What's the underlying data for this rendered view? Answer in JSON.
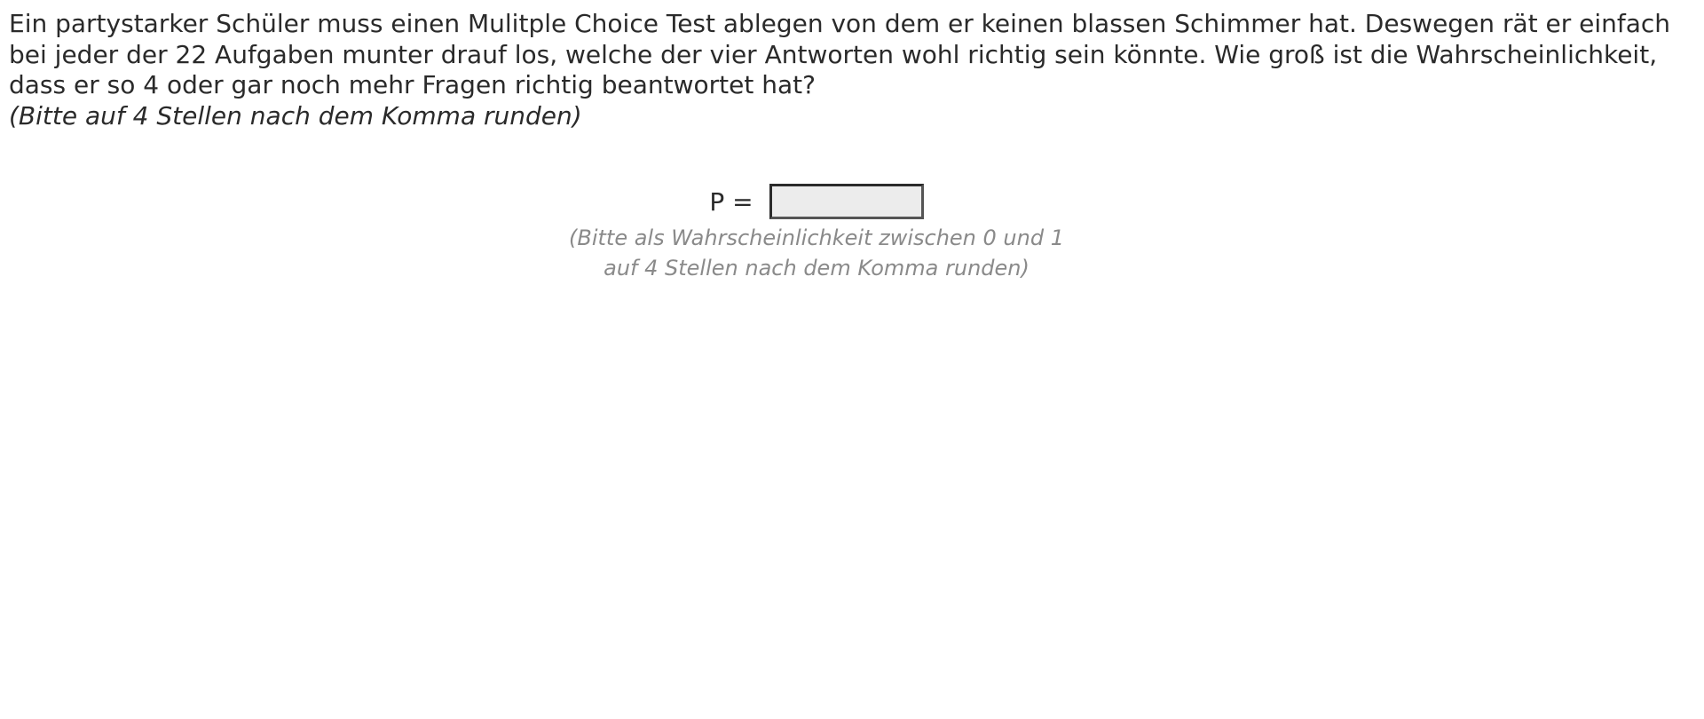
{
  "question": {
    "text": "Ein partystarker Schüler muss einen Mulitple Choice Test ablegen von dem er keinen blassen Schimmer hat. Deswegen rät er einfach bei jeder der 22 Aufgaben munter drauf los, welche der vier Antworten wohl richtig sein könnte. Wie groß ist die Wahrscheinlichkeit, dass er so 4 oder gar noch mehr Fragen richtig beantwortet hat?",
    "hint": "(Bitte auf 4 Stellen nach dem Komma runden)"
  },
  "answer": {
    "label": "P =",
    "value": "",
    "note_line1": "(Bitte als Wahrscheinlichkeit zwischen 0 und 1",
    "note_line2": "auf 4 Stellen nach dem Komma runden)"
  }
}
